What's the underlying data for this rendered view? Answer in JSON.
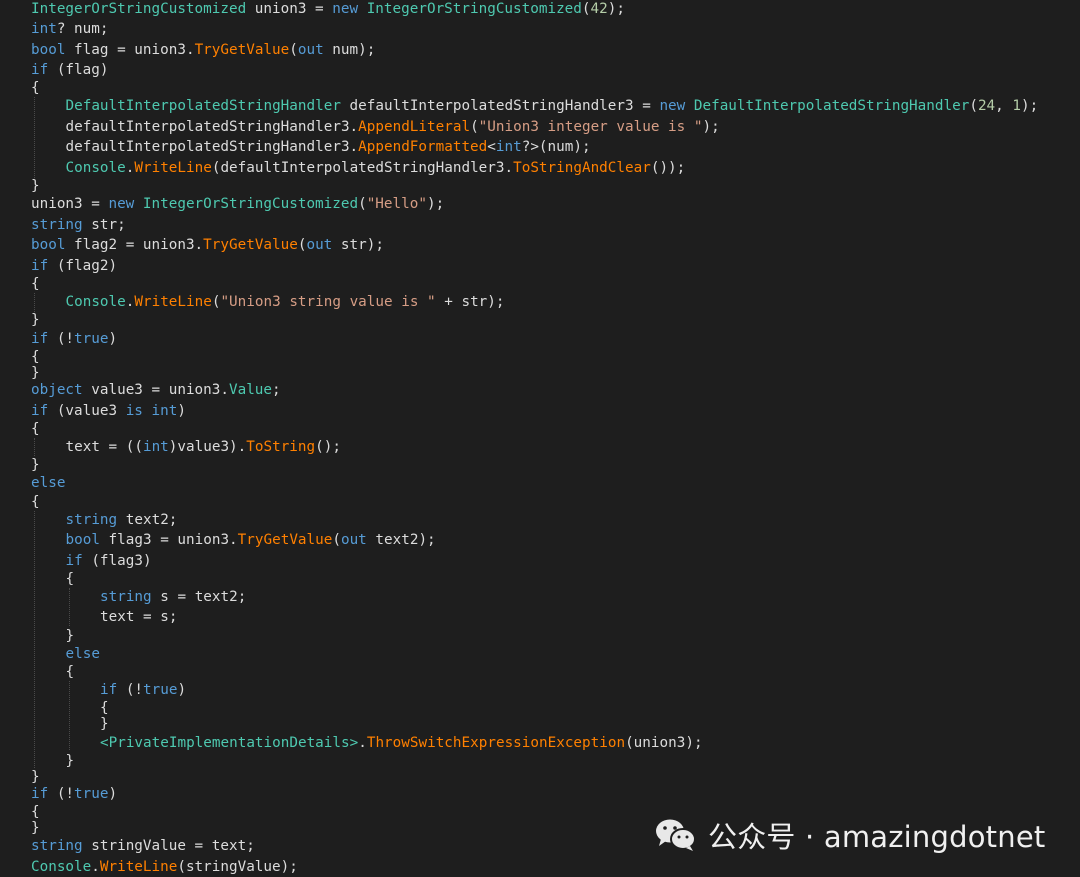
{
  "colors": {
    "background": "#1e1e1e",
    "keyword": "#569cd6",
    "type": "#4ec9b0",
    "method": "#ff8000",
    "string": "#d69d85",
    "number": "#b5cea8",
    "plain": "#dcdcdc"
  },
  "code": {
    "lines": [
      {
        "indent": 0,
        "tokens": [
          [
            "type",
            "IntegerOrStringCustomized"
          ],
          [
            "plain",
            " union3 = "
          ],
          [
            "kw",
            "new"
          ],
          [
            "plain",
            " "
          ],
          [
            "type",
            "IntegerOrStringCustomized"
          ],
          [
            "plain",
            "("
          ],
          [
            "num",
            "42"
          ],
          [
            "plain",
            ");"
          ]
        ]
      },
      {
        "indent": 0,
        "tokens": [
          [
            "kw",
            "int"
          ],
          [
            "plain",
            "? num;"
          ]
        ]
      },
      {
        "indent": 0,
        "tokens": [
          [
            "kw",
            "bool"
          ],
          [
            "plain",
            " flag = union3."
          ],
          [
            "method",
            "TryGetValue"
          ],
          [
            "plain",
            "("
          ],
          [
            "kw",
            "out"
          ],
          [
            "plain",
            " num);"
          ]
        ]
      },
      {
        "indent": 0,
        "tokens": [
          [
            "kw",
            "if"
          ],
          [
            "plain",
            " (flag)"
          ]
        ]
      },
      {
        "indent": 0,
        "tokens": [
          [
            "plain",
            "{"
          ]
        ]
      },
      {
        "indent": 1,
        "tokens": [
          [
            "type",
            "DefaultInterpolatedStringHandler"
          ],
          [
            "plain",
            " defaultInterpolatedStringHandler3 = "
          ],
          [
            "kw",
            "new"
          ],
          [
            "plain",
            " "
          ],
          [
            "type",
            "DefaultInterpolatedStringHandler"
          ],
          [
            "plain",
            "("
          ],
          [
            "num",
            "24"
          ],
          [
            "plain",
            ", "
          ],
          [
            "num",
            "1"
          ],
          [
            "plain",
            ");"
          ]
        ]
      },
      {
        "indent": 1,
        "tokens": [
          [
            "plain",
            "defaultInterpolatedStringHandler3."
          ],
          [
            "method",
            "AppendLiteral"
          ],
          [
            "plain",
            "("
          ],
          [
            "str",
            "\"Union3 integer value is \""
          ],
          [
            "plain",
            ");"
          ]
        ]
      },
      {
        "indent": 1,
        "tokens": [
          [
            "plain",
            "defaultInterpolatedStringHandler3."
          ],
          [
            "method",
            "AppendFormatted"
          ],
          [
            "plain",
            "<"
          ],
          [
            "kw",
            "int"
          ],
          [
            "plain",
            "?>(num);"
          ]
        ]
      },
      {
        "indent": 1,
        "tokens": [
          [
            "type",
            "Console"
          ],
          [
            "plain",
            "."
          ],
          [
            "method",
            "WriteLine"
          ],
          [
            "plain",
            "(defaultInterpolatedStringHandler3."
          ],
          [
            "method",
            "ToStringAndClear"
          ],
          [
            "plain",
            "());"
          ]
        ]
      },
      {
        "indent": 0,
        "tokens": [
          [
            "plain",
            "}"
          ]
        ]
      },
      {
        "indent": 0,
        "tokens": [
          [
            "plain",
            "union3 = "
          ],
          [
            "kw",
            "new"
          ],
          [
            "plain",
            " "
          ],
          [
            "type",
            "IntegerOrStringCustomized"
          ],
          [
            "plain",
            "("
          ],
          [
            "str",
            "\"Hello\""
          ],
          [
            "plain",
            ");"
          ]
        ]
      },
      {
        "indent": 0,
        "tokens": [
          [
            "kw",
            "string"
          ],
          [
            "plain",
            " str;"
          ]
        ]
      },
      {
        "indent": 0,
        "tokens": [
          [
            "kw",
            "bool"
          ],
          [
            "plain",
            " flag2 = union3."
          ],
          [
            "method",
            "TryGetValue"
          ],
          [
            "plain",
            "("
          ],
          [
            "kw",
            "out"
          ],
          [
            "plain",
            " str);"
          ]
        ]
      },
      {
        "indent": 0,
        "tokens": [
          [
            "kw",
            "if"
          ],
          [
            "plain",
            " (flag2)"
          ]
        ]
      },
      {
        "indent": 0,
        "tokens": [
          [
            "plain",
            "{"
          ]
        ]
      },
      {
        "indent": 1,
        "tokens": [
          [
            "type",
            "Console"
          ],
          [
            "plain",
            "."
          ],
          [
            "method",
            "WriteLine"
          ],
          [
            "plain",
            "("
          ],
          [
            "str",
            "\"Union3 string value is \""
          ],
          [
            "plain",
            " + str);"
          ]
        ]
      },
      {
        "indent": 0,
        "tokens": [
          [
            "plain",
            "}"
          ]
        ]
      },
      {
        "indent": 0,
        "tokens": [
          [
            "kw",
            "if"
          ],
          [
            "plain",
            " (!"
          ],
          [
            "kw",
            "true"
          ],
          [
            "plain",
            ")"
          ]
        ]
      },
      {
        "indent": 0,
        "tokens": [
          [
            "plain",
            "{"
          ]
        ]
      },
      {
        "indent": 0,
        "tokens": [
          [
            "plain",
            "}"
          ]
        ]
      },
      {
        "indent": 0,
        "tokens": [
          [
            "kw",
            "object"
          ],
          [
            "plain",
            " value3 = union3."
          ],
          [
            "type",
            "Value"
          ],
          [
            "plain",
            ";"
          ]
        ]
      },
      {
        "indent": 0,
        "tokens": [
          [
            "kw",
            "if"
          ],
          [
            "plain",
            " (value3 "
          ],
          [
            "kw",
            "is"
          ],
          [
            "plain",
            " "
          ],
          [
            "kw",
            "int"
          ],
          [
            "plain",
            ")"
          ]
        ]
      },
      {
        "indent": 0,
        "tokens": [
          [
            "plain",
            "{"
          ]
        ]
      },
      {
        "indent": 1,
        "tokens": [
          [
            "plain",
            "text = (("
          ],
          [
            "kw",
            "int"
          ],
          [
            "plain",
            ")value3)."
          ],
          [
            "method",
            "ToString"
          ],
          [
            "plain",
            "();"
          ]
        ]
      },
      {
        "indent": 0,
        "tokens": [
          [
            "plain",
            "}"
          ]
        ]
      },
      {
        "indent": 0,
        "tokens": [
          [
            "kw",
            "else"
          ]
        ]
      },
      {
        "indent": 0,
        "tokens": [
          [
            "plain",
            "{"
          ]
        ]
      },
      {
        "indent": 1,
        "tokens": [
          [
            "kw",
            "string"
          ],
          [
            "plain",
            " text2;"
          ]
        ]
      },
      {
        "indent": 1,
        "tokens": [
          [
            "kw",
            "bool"
          ],
          [
            "plain",
            " flag3 = union3."
          ],
          [
            "method",
            "TryGetValue"
          ],
          [
            "plain",
            "("
          ],
          [
            "kw",
            "out"
          ],
          [
            "plain",
            " text2);"
          ]
        ]
      },
      {
        "indent": 1,
        "tokens": [
          [
            "kw",
            "if"
          ],
          [
            "plain",
            " (flag3)"
          ]
        ]
      },
      {
        "indent": 1,
        "tokens": [
          [
            "plain",
            "{"
          ]
        ]
      },
      {
        "indent": 2,
        "tokens": [
          [
            "kw",
            "string"
          ],
          [
            "plain",
            " s = text2;"
          ]
        ]
      },
      {
        "indent": 2,
        "tokens": [
          [
            "plain",
            "text = s;"
          ]
        ]
      },
      {
        "indent": 1,
        "tokens": [
          [
            "plain",
            "}"
          ]
        ]
      },
      {
        "indent": 1,
        "tokens": [
          [
            "kw",
            "else"
          ]
        ]
      },
      {
        "indent": 1,
        "tokens": [
          [
            "plain",
            "{"
          ]
        ]
      },
      {
        "indent": 2,
        "tokens": [
          [
            "kw",
            "if"
          ],
          [
            "plain",
            " (!"
          ],
          [
            "kw",
            "true"
          ],
          [
            "plain",
            ")"
          ]
        ]
      },
      {
        "indent": 2,
        "tokens": [
          [
            "plain",
            "{"
          ]
        ]
      },
      {
        "indent": 2,
        "tokens": [
          [
            "plain",
            "}"
          ]
        ]
      },
      {
        "indent": 2,
        "tokens": [
          [
            "type",
            "<PrivateImplementationDetails>"
          ],
          [
            "plain",
            "."
          ],
          [
            "method",
            "ThrowSwitchExpressionException"
          ],
          [
            "plain",
            "(union3);"
          ]
        ]
      },
      {
        "indent": 1,
        "tokens": [
          [
            "plain",
            "}"
          ]
        ]
      },
      {
        "indent": 0,
        "tokens": [
          [
            "plain",
            "}"
          ]
        ]
      },
      {
        "indent": 0,
        "tokens": [
          [
            "kw",
            "if"
          ],
          [
            "plain",
            " (!"
          ],
          [
            "kw",
            "true"
          ],
          [
            "plain",
            ")"
          ]
        ]
      },
      {
        "indent": 0,
        "tokens": [
          [
            "plain",
            "{"
          ]
        ]
      },
      {
        "indent": 0,
        "tokens": [
          [
            "plain",
            "}"
          ]
        ]
      },
      {
        "indent": 0,
        "tokens": [
          [
            "kw",
            "string"
          ],
          [
            "plain",
            " stringValue = text;"
          ]
        ]
      },
      {
        "indent": 0,
        "tokens": [
          [
            "type",
            "Console"
          ],
          [
            "plain",
            "."
          ],
          [
            "method",
            "WriteLine"
          ],
          [
            "plain",
            "(stringValue);"
          ]
        ]
      }
    ]
  },
  "watermark": {
    "icon": "wechat-icon",
    "text": "公众号 · amazingdotnet"
  }
}
